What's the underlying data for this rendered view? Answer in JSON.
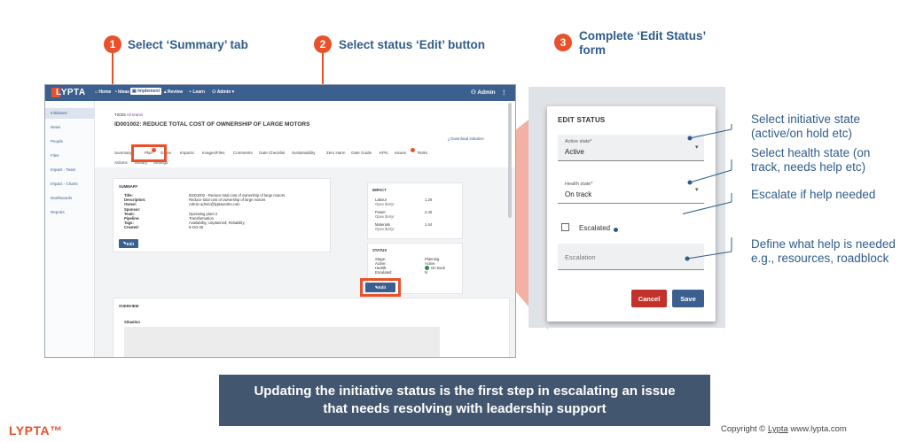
{
  "steps": [
    {
      "num": "1",
      "text": "Select ‘Summary’ tab"
    },
    {
      "num": "2",
      "text": "Select status ‘Edit’ button"
    },
    {
      "num": "3",
      "text_line1": "Complete ‘Edit Status’",
      "text_line2": "form"
    }
  ],
  "app": {
    "logo": "LYPTA",
    "nav": [
      "Home",
      "Ideas",
      "Implement",
      "Review",
      "Learn",
      "Admin"
    ],
    "admin_label": "Admin",
    "sidebar": [
      "Initiatives",
      "News",
      "People",
      "Files",
      "Impact - Team",
      "Impact - Charts",
      "Dashboards",
      "Reports"
    ],
    "breadcrumb": "T2025 · All teams",
    "breadcrumb_team": "T2025",
    "breadcrumb_link": "All teams",
    "page_title": "ID001002: REDUCE TOTAL COST OF OWNERSHIP OF LARGE MOTORS",
    "download_label": "Download initiative",
    "tabs": [
      "Summary",
      "Plan",
      "Gates",
      "Impacts",
      "Images/Files",
      "Comments",
      "Gate Checklist",
      "Sustainability",
      "Zero Harm",
      "Gate Guide",
      "KPIs",
      "Issues",
      "Risks"
    ],
    "subtabs": [
      "Actions",
      "History",
      "Settings"
    ],
    "summary": {
      "title": "SUMMARY",
      "rows": [
        {
          "k": "Title:",
          "v": "ID001002 - Reduce total cost of ownership of large motors"
        },
        {
          "k": "Description:",
          "v": "Reduce total cost of ownership of large motors"
        },
        {
          "k": "Owner:",
          "v": "Admin  admin@lyptaworks.com"
        },
        {
          "k": "Sponsor:",
          "v": ""
        },
        {
          "k": "Team:",
          "v": "Operating plant 2"
        },
        {
          "k": "Pipeline:",
          "v": "Transformation"
        },
        {
          "k": "Tags:",
          "v": "Availability; Unplanned; Reliability;"
        },
        {
          "k": "Created:",
          "v": "6-Oct-25"
        }
      ],
      "edit_label": "Edit"
    },
    "impact": {
      "title": "IMPACT",
      "rows": [
        {
          "k": "Labour",
          "sub": "Opex $m/yr",
          "v": "1.20"
        },
        {
          "k": "Power",
          "sub": "Opex $m/yr",
          "v": "2.40"
        },
        {
          "k": "Materials",
          "sub": "Opex $m/yr",
          "v": "1.44"
        }
      ]
    },
    "status": {
      "title": "STATUS",
      "rows": [
        {
          "k": "Stage:",
          "v": "Planning"
        },
        {
          "k": "Active:",
          "v": "Active"
        },
        {
          "k": "Health:",
          "v": "On track"
        },
        {
          "k": "Escalated:",
          "v": "N"
        }
      ],
      "edit_label": "Edit"
    },
    "overview": {
      "title": "OVERVIEW",
      "situation": "Situation"
    }
  },
  "form": {
    "title": "EDIT STATUS",
    "active_label": "Active state*",
    "active_value": "Active",
    "health_label": "Health state*",
    "health_value": "On track",
    "escalated_label": "Escalated",
    "escalation_placeholder": "Escalation",
    "cancel": "Cancel",
    "save": "Save"
  },
  "annotations": [
    {
      "line1": "Select initiative state",
      "line2": "(active/on hold etc)"
    },
    {
      "line1": "Select health state (on",
      "line2": "track, needs help etc)"
    },
    {
      "line1": "Escalate if help needed",
      "line2": ""
    },
    {
      "line1": "Define what help is needed",
      "line2": "e.g., resources, roadblock"
    }
  ],
  "banner": {
    "line1": "Updating the initiative status is the first step in escalating an issue",
    "line2": "that needs resolving with leadership support"
  },
  "footer": {
    "logo": "LYPTA™",
    "copyright_prefix": "Copyright © ",
    "copyright_link": "Lypta",
    "copyright_suffix": "  www.lypta.com"
  },
  "colors": {
    "accent": "#e8512b",
    "brand": "#3b5f8f",
    "banner": "#43566f",
    "text_blue": "#2f5c8a"
  }
}
